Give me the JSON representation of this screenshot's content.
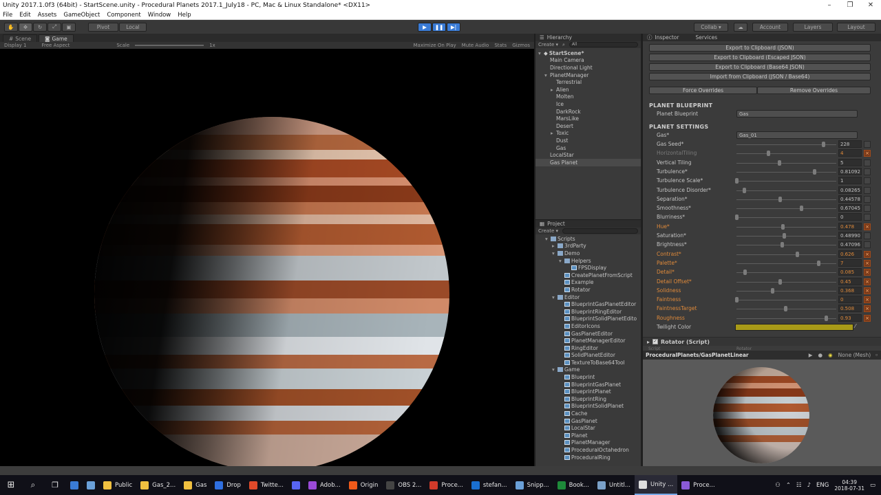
{
  "window": {
    "title": "Unity 2017.1.0f3 (64bit) - StartScene.unity - Procedural Planets 2017.1_July18 - PC, Mac & Linux Standalone* <DX11>",
    "min": "–",
    "max": "❐",
    "close": "✕"
  },
  "menu": [
    "File",
    "Edit",
    "Assets",
    "GameObject",
    "Component",
    "Window",
    "Help"
  ],
  "toolbar": {
    "pivot": "Pivot",
    "local": "Local",
    "collab": "Collab ▾",
    "account": "Account",
    "layers": "Layers",
    "layout": "Layout"
  },
  "game": {
    "tabs": [
      "Scene",
      "Game"
    ],
    "display": "Display 1",
    "aspect": "Free Aspect",
    "scale_label": "Scale",
    "scale_value": "1x",
    "options": [
      "Maximize On Play",
      "Mute Audio",
      "Stats",
      "Gizmos"
    ]
  },
  "hierarchy": {
    "title": "Hierarchy",
    "create": "Create ▾",
    "search": "All",
    "items": [
      {
        "label": "StartScene*",
        "indent": 0,
        "arrow": "▾"
      },
      {
        "label": "Main Camera",
        "indent": 1,
        "arrow": ""
      },
      {
        "label": "Directional Light",
        "indent": 1,
        "arrow": ""
      },
      {
        "label": "PlanetManager",
        "indent": 1,
        "arrow": "▾"
      },
      {
        "label": "Terrestrial",
        "indent": 2,
        "arrow": ""
      },
      {
        "label": "Alien",
        "indent": 2,
        "arrow": "▸"
      },
      {
        "label": "Molten",
        "indent": 2,
        "arrow": ""
      },
      {
        "label": "Ice",
        "indent": 2,
        "arrow": ""
      },
      {
        "label": "DarkRock",
        "indent": 2,
        "arrow": ""
      },
      {
        "label": "MarsLike",
        "indent": 2,
        "arrow": ""
      },
      {
        "label": "Desert",
        "indent": 2,
        "arrow": ""
      },
      {
        "label": "Toxic",
        "indent": 2,
        "arrow": "▸"
      },
      {
        "label": "Dust",
        "indent": 2,
        "arrow": ""
      },
      {
        "label": "Gas",
        "indent": 2,
        "arrow": ""
      },
      {
        "label": "LocalStar",
        "indent": 1,
        "arrow": ""
      },
      {
        "label": "Gas Planet",
        "indent": 1,
        "arrow": "",
        "selected": true
      }
    ]
  },
  "project": {
    "title": "Project",
    "create": "Create ▾",
    "items": [
      {
        "label": "Scripts",
        "indent": 0,
        "arrow": "▾",
        "folder": true
      },
      {
        "label": "3rdParty",
        "indent": 1,
        "arrow": "▸",
        "folder": true
      },
      {
        "label": "Demo",
        "indent": 1,
        "arrow": "▾",
        "folder": true
      },
      {
        "label": "Helpers",
        "indent": 2,
        "arrow": "▾",
        "folder": true
      },
      {
        "label": "FPSDisplay",
        "indent": 3,
        "arrow": "",
        "folder": false
      },
      {
        "label": "CreatePlanetFromScript",
        "indent": 2,
        "arrow": "",
        "folder": false
      },
      {
        "label": "Example",
        "indent": 2,
        "arrow": "",
        "folder": false
      },
      {
        "label": "Rotator",
        "indent": 2,
        "arrow": "",
        "folder": false
      },
      {
        "label": "Editor",
        "indent": 1,
        "arrow": "▾",
        "folder": true
      },
      {
        "label": "BlueprintGasPlanetEditor",
        "indent": 2,
        "arrow": "",
        "folder": false
      },
      {
        "label": "BlueprintRingEditor",
        "indent": 2,
        "arrow": "",
        "folder": false
      },
      {
        "label": "BlueprintSolidPlanetEdito",
        "indent": 2,
        "arrow": "",
        "folder": false
      },
      {
        "label": "EditorIcons",
        "indent": 2,
        "arrow": "",
        "folder": false
      },
      {
        "label": "GasPlanetEditor",
        "indent": 2,
        "arrow": "",
        "folder": false
      },
      {
        "label": "PlanetManagerEditor",
        "indent": 2,
        "arrow": "",
        "folder": false
      },
      {
        "label": "RingEditor",
        "indent": 2,
        "arrow": "",
        "folder": false
      },
      {
        "label": "SolidPlanetEditor",
        "indent": 2,
        "arrow": "",
        "folder": false
      },
      {
        "label": "TextureToBase64Tool",
        "indent": 2,
        "arrow": "",
        "folder": false
      },
      {
        "label": "Game",
        "indent": 1,
        "arrow": "▾",
        "folder": true
      },
      {
        "label": "Blueprint",
        "indent": 2,
        "arrow": "",
        "folder": false
      },
      {
        "label": "BlueprintGasPlanet",
        "indent": 2,
        "arrow": "",
        "folder": false
      },
      {
        "label": "BlueprintPlanet",
        "indent": 2,
        "arrow": "",
        "folder": false
      },
      {
        "label": "BlueprintRing",
        "indent": 2,
        "arrow": "",
        "folder": false
      },
      {
        "label": "BlueprintSolidPlanet",
        "indent": 2,
        "arrow": "",
        "folder": false
      },
      {
        "label": "Cache",
        "indent": 2,
        "arrow": "",
        "folder": false
      },
      {
        "label": "GasPlanet",
        "indent": 2,
        "arrow": "",
        "folder": false
      },
      {
        "label": "LocalStar",
        "indent": 2,
        "arrow": "",
        "folder": false
      },
      {
        "label": "Planet",
        "indent": 2,
        "arrow": "",
        "folder": false
      },
      {
        "label": "PlanetManager",
        "indent": 2,
        "arrow": "",
        "folder": false
      },
      {
        "label": "ProceduralOctahedron",
        "indent": 2,
        "arrow": "",
        "folder": false
      },
      {
        "label": "ProceduralRing",
        "indent": 2,
        "arrow": "",
        "folder": false
      }
    ]
  },
  "inspector": {
    "tabs": [
      "Inspector",
      "Services"
    ],
    "export_buttons": [
      "Export to Clipboard (JSON)",
      "Export to Clipboard (Escaped JSON)",
      "Export to Clipboard (Base64 JSON)",
      "Import from Clipboard (JSON / Base64)"
    ],
    "force_overrides": "Force Overrides",
    "remove_overrides": "Remove Overrides",
    "blueprint_heading": "PLANET BLUEPRINT",
    "blueprint_label": "Planet Blueprint",
    "blueprint_value": "Gas",
    "settings_heading": "PLANET SETTINGS",
    "gas_label": "Gas*",
    "gas_value": "Gas_01",
    "sliders": [
      {
        "label": "Gas Seed*",
        "value": "228",
        "pos": 0.9,
        "style": "normal",
        "override": false
      },
      {
        "label": "HorizontalTiling",
        "value": "4",
        "pos": 0.33,
        "style": "dim",
        "override": true
      },
      {
        "label": "Vertical Tiling",
        "value": "5",
        "pos": 0.44,
        "style": "normal",
        "override": false
      },
      {
        "label": "Turbulence*",
        "value": "0.81092",
        "pos": 0.81,
        "style": "normal",
        "override": false
      },
      {
        "label": "Turbulence Scale*",
        "value": "1",
        "pos": 0.0,
        "style": "normal",
        "override": false
      },
      {
        "label": "Turbulence Disorder*",
        "value": "0.08265",
        "pos": 0.08,
        "style": "normal",
        "override": false
      },
      {
        "label": "Separation*",
        "value": "0.44578",
        "pos": 0.45,
        "style": "normal",
        "override": false
      },
      {
        "label": "Smoothness*",
        "value": "0.67045",
        "pos": 0.67,
        "style": "normal",
        "override": false
      },
      {
        "label": "Blurriness*",
        "value": "0",
        "pos": 0.0,
        "style": "normal",
        "override": false
      },
      {
        "label": "Hue*",
        "value": "0.478",
        "pos": 0.48,
        "style": "orange",
        "override": true
      },
      {
        "label": "Saturation*",
        "value": "0.48990",
        "pos": 0.49,
        "style": "normal",
        "override": false
      },
      {
        "label": "Brightness*",
        "value": "0.47096",
        "pos": 0.47,
        "style": "normal",
        "override": false
      },
      {
        "label": "Contrast*",
        "value": "0.626",
        "pos": 0.63,
        "style": "orange",
        "override": true
      },
      {
        "label": "Palette*",
        "value": "7",
        "pos": 0.85,
        "style": "orange",
        "override": true
      },
      {
        "label": "Detail*",
        "value": "0.085",
        "pos": 0.085,
        "style": "orange",
        "override": true
      },
      {
        "label": "Detail Offset*",
        "value": "0.45",
        "pos": 0.45,
        "style": "orange",
        "override": true
      },
      {
        "label": "Solidness",
        "value": "0.368",
        "pos": 0.37,
        "style": "orange",
        "override": true
      },
      {
        "label": "Faintness",
        "value": "0",
        "pos": 0.0,
        "style": "orange",
        "override": true
      },
      {
        "label": "FaintnessTarget",
        "value": "0.508",
        "pos": 0.51,
        "style": "orange",
        "override": true
      },
      {
        "label": "Roughness",
        "value": "0.93",
        "pos": 0.93,
        "style": "orange",
        "override": true
      }
    ],
    "twilight_label": "Twilight Color",
    "twilight_color": "#a89a18",
    "rotator": "Rotator (Script)",
    "script_label": "Script",
    "script_value": "Rotator",
    "preview_title": "ProceduralPlanets/GasPlanetLinear",
    "preview_mesh": "None (Mesh)"
  },
  "taskbar": {
    "items": [
      {
        "label": "",
        "color": "#3a7bd5"
      },
      {
        "label": "",
        "color": "#6aa0d8"
      },
      {
        "label": "Public",
        "color": "#f0c040"
      },
      {
        "label": "Gas_2...",
        "color": "#f0c040"
      },
      {
        "label": "Gas",
        "color": "#f0c040"
      },
      {
        "label": "Drop",
        "color": "#2f6fe0"
      },
      {
        "label": "Twitte...",
        "color": "#e04a2a"
      },
      {
        "label": "",
        "color": "#5865f2"
      },
      {
        "label": "Adob...",
        "color": "#9a4ad8"
      },
      {
        "label": "Origin",
        "color": "#f05a1a"
      },
      {
        "label": "OBS 2...",
        "color": "#444444"
      },
      {
        "label": "Proce...",
        "color": "#d03a2a"
      },
      {
        "label": "stefan...",
        "color": "#1a6fd0"
      },
      {
        "label": "Snipp...",
        "color": "#6aa0d8"
      },
      {
        "label": "Book...",
        "color": "#1e8a3a"
      },
      {
        "label": "Untitl...",
        "color": "#7aa0c8"
      },
      {
        "label": "Unity ...",
        "color": "#dddddd",
        "active": true
      },
      {
        "label": "Proce...",
        "color": "#8a5ad8"
      }
    ],
    "lang": "ENG",
    "time": "04:39",
    "date": "2018-07-31"
  }
}
